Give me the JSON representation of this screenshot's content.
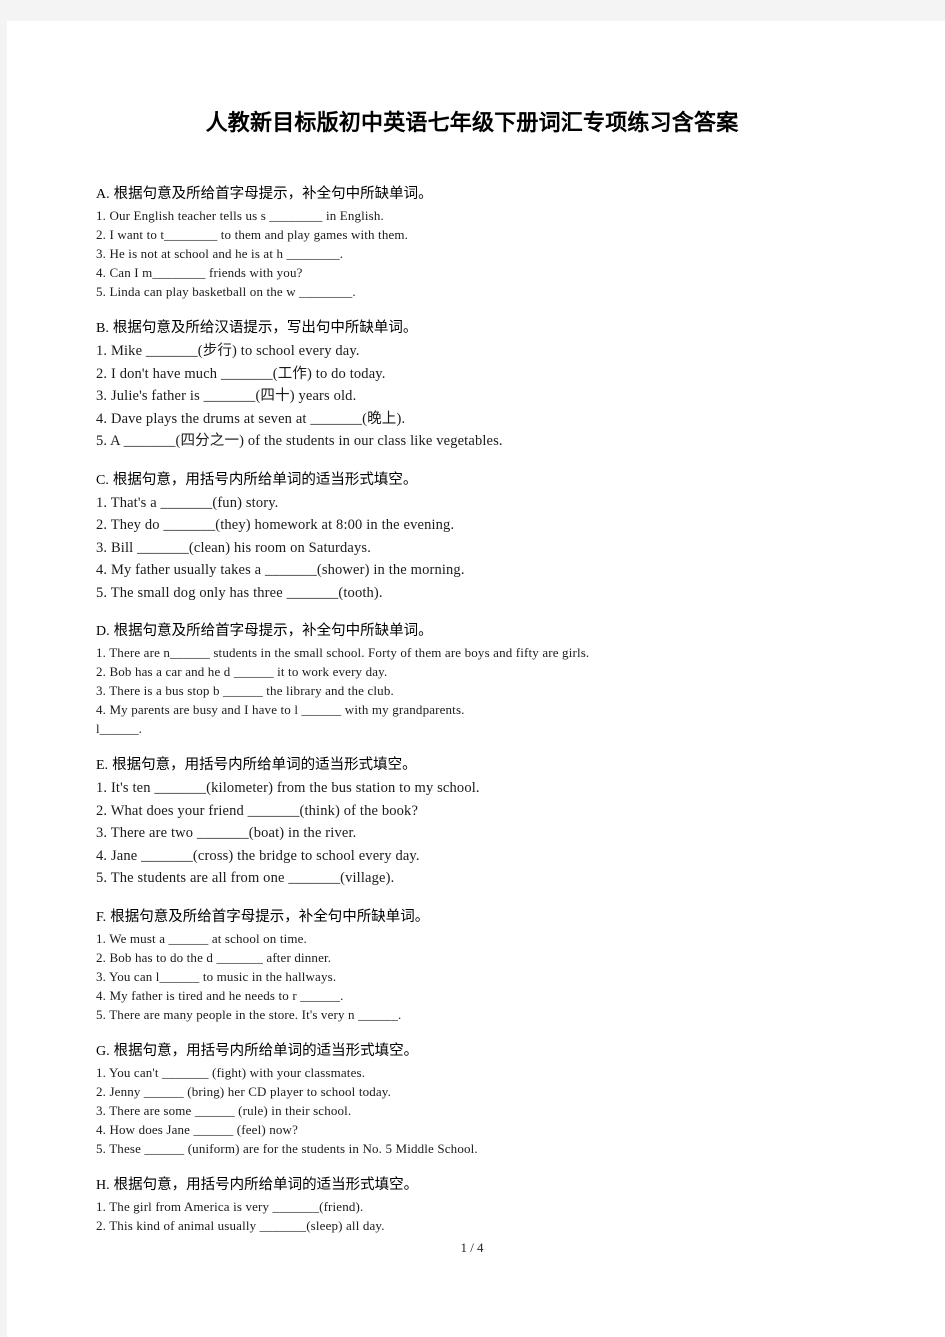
{
  "document": {
    "title": "人教新目标版初中英语七年级下册词汇专项练习含答案",
    "footer": "1 / 4"
  },
  "sections": [
    {
      "letter": "A.",
      "heading": "根据句意及所给首字母提示，补全句中所缺单词。",
      "density": "tight",
      "items": [
        "1. Our English teacher tells us s ________ in English.",
        "2. I want to t________ to them and play games with them.",
        "3. He is not at school and he is at h ________.",
        "4. Can I m________ friends with you?",
        "5. Linda can play basketball on the w ________."
      ]
    },
    {
      "letter": "B.",
      "heading": "根据句意及所给汉语提示，写出句中所缺单词。",
      "density": "loose",
      "items": [
        "1. Mike _______(步行) to school every day.",
        "2. I don't have much _______(工作) to do today.",
        "3. Julie's father is _______(四十) years old.",
        "4. Dave plays the drums at seven at _______(晚上).",
        "5. A _______(四分之一) of the students in our class like vegetables."
      ]
    },
    {
      "letter": "C.",
      "heading": "根据句意，用括号内所给单词的适当形式填空。",
      "density": "loose",
      "items": [
        "1. That's a _______(fun) story.",
        "2. They do _______(they) homework at 8:00 in the evening.",
        "3. Bill _______(clean) his room on Saturdays.",
        "4. My father usually takes a _______(shower) in the morning.",
        "5. The small dog only has three _______(tooth)."
      ]
    },
    {
      "letter": "D.",
      "heading": "根据句意及所给首字母提示，补全句中所缺单词。",
      "density": "tight",
      "items": [
        "1. There are n______ students in the small school. Forty of them are boys and fifty are girls.",
        "2. Bob has a car and he d ______ it to work every day.",
        "3. There is a bus stop b ______ the library and the club.",
        "4. My parents are busy and I have to l ______ with my grandparents."
      ],
      "continuation": "l______."
    },
    {
      "letter": "E.",
      "heading": "根据句意，用括号内所给单词的适当形式填空。",
      "density": "loose",
      "items": [
        "1. It's ten _______(kilometer) from the bus station to my school.",
        "2. What does your friend _______(think) of the book?",
        "3. There are two _______(boat) in the river.",
        "4. Jane _______(cross) the bridge to school every day.",
        "5. The students are all from one _______(village)."
      ]
    },
    {
      "letter": "F.",
      "heading": "根据句意及所给首字母提示，补全句中所缺单词。",
      "density": "tight",
      "items": [
        "1. We must a ______ at school on time.",
        "2. Bob has to do the d _______ after dinner.",
        "3. You can l______ to music in the hallways.",
        "4. My father is tired and he needs to r ______.",
        "5. There are many people in the store. It's very n ______."
      ]
    },
    {
      "letter": "G.",
      "heading": "根据句意，用括号内所给单词的适当形式填空。",
      "density": "tight",
      "items": [
        "1. You can't _______ (fight) with your classmates.",
        "2. Jenny ______ (bring) her CD player to school today.",
        "3. There are some ______ (rule) in their school.",
        "4. How does Jane ______ (feel) now?",
        "5. These ______ (uniform) are for the students in No. 5 Middle School."
      ]
    },
    {
      "letter": "H.",
      "heading": "根据句意，用括号内所给单词的适当形式填空。",
      "density": "tight",
      "items": [
        "1. The girl from America is very _______(friend).",
        "2. This kind of animal usually _______(sleep) all day."
      ]
    }
  ]
}
